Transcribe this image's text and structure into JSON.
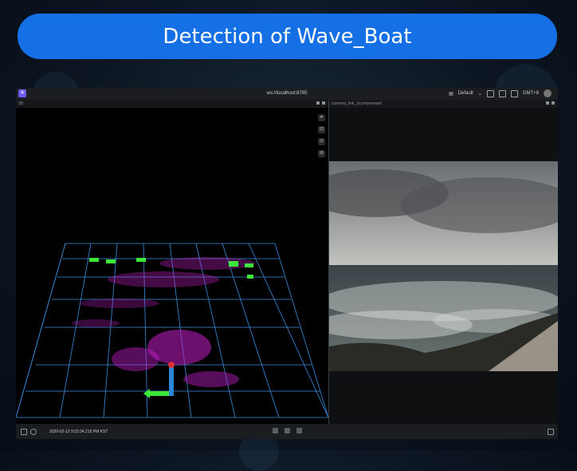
{
  "banner": {
    "title": "Detection of Wave_Boat"
  },
  "window": {
    "url": "ws://localhost:8765",
    "layout_label": "Default",
    "user_badge": "GMT+9"
  },
  "panels": {
    "left": {
      "title": "3D"
    },
    "right": {
      "title": "/camera_link_1/compressed"
    }
  },
  "status": {
    "timestamp": "2020-02-12 9:22:34.216 PM KST"
  },
  "colors": {
    "banner": "#1570e6",
    "pointcloud": "#c21fc7",
    "grid": "#3a8fe0",
    "detection": "#3ee63a"
  },
  "icons": [
    "app-logo-icon",
    "layout-icon",
    "panel-icon",
    "sidebar-icon",
    "avatar-icon",
    "select-icon",
    "measure-icon",
    "pin-icon",
    "center-icon",
    "play-icon",
    "prev-icon",
    "next-icon"
  ]
}
